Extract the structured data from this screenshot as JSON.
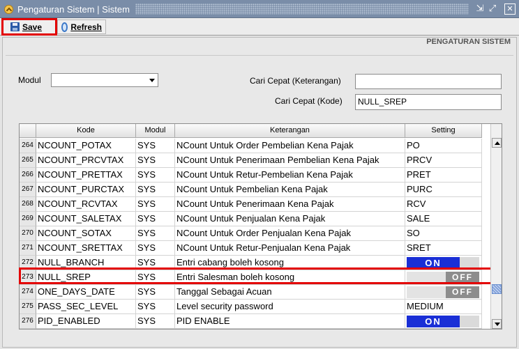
{
  "window": {
    "title": "Pengaturan Sistem | Sistem",
    "controls": {
      "restore": "⇲",
      "maximize": "⤢",
      "close": "✕"
    }
  },
  "toolbar": {
    "save_label": "Save",
    "refresh_label": "Refresh"
  },
  "panel": {
    "heading": "PENGATURAN SISTEM"
  },
  "filters": {
    "modul_label": "Modul",
    "modul_value": "",
    "cari_keterangan_label": "Cari Cepat (Keterangan)",
    "cari_keterangan_value": "",
    "cari_kode_label": "Cari Cepat (Kode)",
    "cari_kode_value": "NULL_SREP"
  },
  "grid": {
    "columns": [
      "Kode",
      "Modul",
      "Keterangan",
      "Setting"
    ],
    "rows": [
      {
        "no": "264",
        "kode": "NCOUNT_POTAX",
        "modul": "SYS",
        "keterangan": "NCount Untuk Order Pembelian Kena Pajak",
        "setting": "PO",
        "type": "text"
      },
      {
        "no": "265",
        "kode": "NCOUNT_PRCVTAX",
        "modul": "SYS",
        "keterangan": "NCount Untuk Penerimaan Pembelian Kena Pajak",
        "setting": "PRCV",
        "type": "text"
      },
      {
        "no": "266",
        "kode": "NCOUNT_PRETTAX",
        "modul": "SYS",
        "keterangan": "NCount Untuk Retur-Pembelian Kena Pajak",
        "setting": "PRET",
        "type": "text"
      },
      {
        "no": "267",
        "kode": "NCOUNT_PURCTAX",
        "modul": "SYS",
        "keterangan": "NCount Untuk Pembelian Kena Pajak",
        "setting": "PURC",
        "type": "text"
      },
      {
        "no": "268",
        "kode": "NCOUNT_RCVTAX",
        "modul": "SYS",
        "keterangan": "NCount Untuk Penerimaan Kena Pajak",
        "setting": "RCV",
        "type": "text"
      },
      {
        "no": "269",
        "kode": "NCOUNT_SALETAX",
        "modul": "SYS",
        "keterangan": "NCount Untuk Penjualan Kena Pajak",
        "setting": "SALE",
        "type": "text"
      },
      {
        "no": "270",
        "kode": "NCOUNT_SOTAX",
        "modul": "SYS",
        "keterangan": "NCount Untuk Order Penjualan Kena Pajak",
        "setting": "SO",
        "type": "text"
      },
      {
        "no": "271",
        "kode": "NCOUNT_SRETTAX",
        "modul": "SYS",
        "keterangan": "NCount Untuk Retur-Penjualan Kena Pajak",
        "setting": "SRET",
        "type": "text"
      },
      {
        "no": "272",
        "kode": "NULL_BRANCH",
        "modul": "SYS",
        "keterangan": "Entri cabang boleh kosong",
        "setting": "ON",
        "type": "on"
      },
      {
        "no": "273",
        "kode": "NULL_SREP",
        "modul": "SYS",
        "keterangan": "Entri Salesman boleh kosong",
        "setting": "OFF",
        "type": "off"
      },
      {
        "no": "274",
        "kode": "ONE_DAYS_DATE",
        "modul": "SYS",
        "keterangan": "Tanggal Sebagai Acuan",
        "setting": "OFF",
        "type": "off"
      },
      {
        "no": "275",
        "kode": "PASS_SEC_LEVEL",
        "modul": "SYS",
        "keterangan": "Level security password",
        "setting": "MEDIUM",
        "type": "text"
      },
      {
        "no": "276",
        "kode": "PID_ENABLED",
        "modul": "SYS",
        "keterangan": "PID ENABLE",
        "setting": "ON",
        "type": "on"
      }
    ]
  },
  "colors": {
    "highlight": "#e30000",
    "toggle_on": "#1a2fd6",
    "toggle_off": "#8d8d8d",
    "titlebar": "#7a8da8"
  }
}
